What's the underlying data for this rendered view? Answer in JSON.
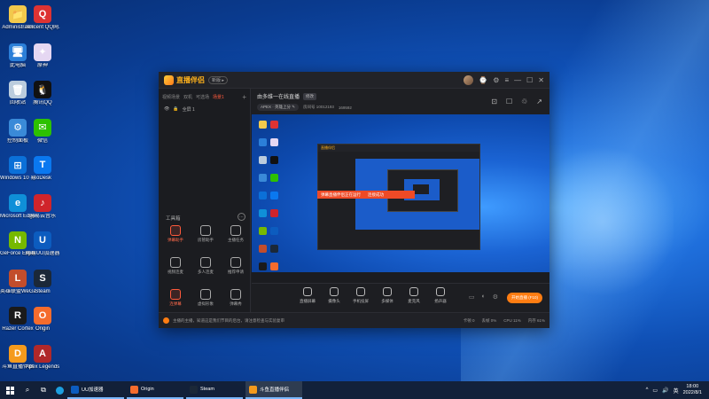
{
  "desktop": {
    "icons": [
      {
        "label": "Administrator",
        "color": "#f2c94c",
        "glyph": "📁"
      },
      {
        "label": "Tencent QQ网...",
        "color": "#d33",
        "glyph": "Q"
      },
      {
        "label": "此电脑",
        "color": "#2b7fd8",
        "glyph": "🖥"
      },
      {
        "label": "原神",
        "color": "#e5d7f2",
        "glyph": "✦"
      },
      {
        "label": "回收站",
        "color": "#bcd",
        "glyph": "🗑"
      },
      {
        "label": "腾讯QQ",
        "color": "#111",
        "glyph": "🐧"
      },
      {
        "label": "控制面板",
        "color": "#3a8ad8",
        "glyph": "⚙"
      },
      {
        "label": "微信",
        "color": "#2dc100",
        "glyph": "✉"
      },
      {
        "label": "Windows 10 易升...",
        "color": "#0b70d8",
        "glyph": "⊞"
      },
      {
        "label": "ToDesk",
        "color": "#0a78f0",
        "glyph": "T"
      },
      {
        "label": "Microsoft Edge",
        "color": "#0f8fd8",
        "glyph": "e"
      },
      {
        "label": "网易云音乐",
        "color": "#d0242b",
        "glyph": "♪"
      },
      {
        "label": "GeForce Experience",
        "color": "#76b900",
        "glyph": "N"
      },
      {
        "label": "网易UU加速器",
        "color": "#0c5cbf",
        "glyph": "U"
      },
      {
        "label": "英雄联盟WeGame版",
        "color": "#c24d2c",
        "glyph": "L"
      },
      {
        "label": "Steam",
        "color": "#1b2838",
        "glyph": "S"
      },
      {
        "label": "Razer Cortex",
        "color": "#1a1a1a",
        "glyph": "R"
      },
      {
        "label": "Origin",
        "color": "#f56c2d",
        "glyph": "O"
      },
      {
        "label": "斗鱼直播伴侣",
        "color": "#f59a1c",
        "glyph": "D"
      },
      {
        "label": "Apex Legends",
        "color": "#b0282a",
        "glyph": "A"
      }
    ]
  },
  "app": {
    "logo_text": "直播伴侣",
    "version_badge": "新版 ▸",
    "window_controls": [
      "⌚",
      "⚙",
      "≡",
      "—",
      "☐",
      "✕"
    ],
    "left_tabs": [
      {
        "label": "视频场景",
        "active": false
      },
      {
        "label": "双机",
        "active": false
      },
      {
        "label": "可选场",
        "active": false
      },
      {
        "label": "场景1",
        "active": true
      }
    ],
    "add_tab": "+",
    "scene_row": {
      "eye": "👁",
      "lock": "🔒",
      "name": "全屏 1"
    },
    "tools_title": "工具箱",
    "tools_more": "⋯",
    "tools": [
      {
        "label": "弹幕助手",
        "hot": true
      },
      {
        "label": "房管助手",
        "hot": false
      },
      {
        "label": "主播任务",
        "hot": false
      },
      {
        "label": "视频连麦",
        "hot": false
      },
      {
        "label": "多人连麦",
        "hot": false
      },
      {
        "label": "推荐申请",
        "hot": false
      },
      {
        "label": "连弹幕",
        "hot": true
      },
      {
        "label": "虚拟形象",
        "hot": false
      },
      {
        "label": "弹幕秀",
        "hot": false
      }
    ],
    "room": {
      "title": "由多维一在线直播",
      "tag": "修改",
      "category": "APEX · 英雄上分",
      "edit_icon": "✎",
      "room_id": "房间号 10012193",
      "heat": "169592",
      "icons": [
        "⊡",
        "☐",
        "♲",
        "↗"
      ]
    },
    "preview": {
      "banner_left": "弹幕直播伴侣正在运行",
      "banner_right": "连接成功"
    },
    "controls": [
      {
        "label": "直播屏幕"
      },
      {
        "label": "摄像头"
      },
      {
        "label": "手机投屏"
      },
      {
        "label": "多媒体"
      },
      {
        "label": "麦克风"
      },
      {
        "label": "扬声器"
      }
    ],
    "bottom_icons": [
      "▭",
      "◐",
      "⚙"
    ],
    "start_button": "开始直播 (F10)",
    "notice": "主播的主播，知道这是我们节目的后台，请注意检查与实验复审",
    "stats": [
      "卡顿 0",
      "丢帧 0%",
      "CPU 11%",
      "内存 61%"
    ]
  },
  "taskbar": {
    "items": [
      {
        "label": "UU加速器",
        "color": "#0c5cbf",
        "active": false
      },
      {
        "label": "Origin",
        "color": "#f56c2d",
        "active": false
      },
      {
        "label": "Steam",
        "color": "#1b2838",
        "active": false
      },
      {
        "label": "斗鱼直播伴侣",
        "color": "#f59a1c",
        "active": true
      }
    ],
    "search_icon": "⌕",
    "taskview_icon": "⧉",
    "tray_icons": [
      "^",
      "▭",
      "🔊",
      "英"
    ],
    "time": "18:00",
    "date": "2022/8/1"
  }
}
